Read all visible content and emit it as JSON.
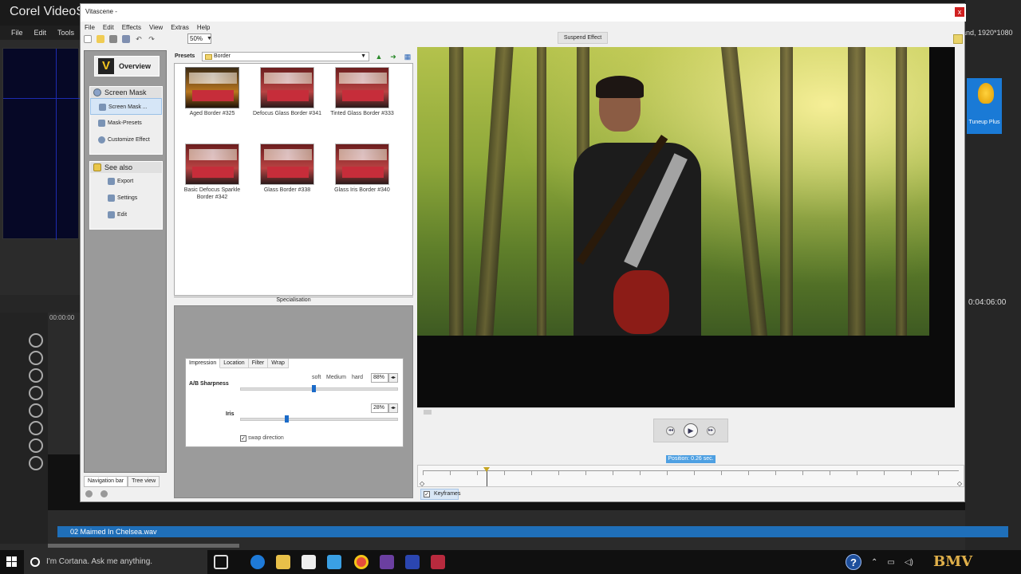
{
  "corel": {
    "app_title": "Corel VideoS",
    "menu": [
      "File",
      "Edit",
      "Tools"
    ],
    "resolution": "and, 1920*1080",
    "timecode": "0:04:06:00",
    "track_timecode": "00:00:00",
    "library_item": "Tuneup Plus",
    "audio_clip": "02 Maimed In Chelsea.wav"
  },
  "vitascene": {
    "title": "Vitascene -",
    "close": "x",
    "menu": [
      "File",
      "Edit",
      "Effects",
      "View",
      "Extras",
      "Help"
    ],
    "zoom": "50%",
    "suspend_label": "Suspend Effect"
  },
  "nav": {
    "overview": "Overview",
    "screen_mask": {
      "title": "Screen Mask",
      "items": [
        "Screen Mask ...",
        "Mask-Presets",
        "Customize Effect"
      ]
    },
    "see_also": {
      "title": "See also",
      "items": [
        "Export",
        "Settings",
        "Edit"
      ]
    },
    "tabs": [
      "Navigation bar",
      "Tree view"
    ]
  },
  "presets": {
    "label": "Presets",
    "folder": "Border",
    "items": [
      {
        "name": "Aged Border #325"
      },
      {
        "name": "Defocus Glass Border #341"
      },
      {
        "name": "Tinted Glass Border #333"
      },
      {
        "name": "Basic Defocus Sparkle Border #342"
      },
      {
        "name": "Glass Border #338"
      },
      {
        "name": "Glass Iris Border #340"
      }
    ]
  },
  "specialisation": {
    "label": "Specialisation",
    "tabs": [
      "Impression",
      "Location",
      "Filter",
      "Wrap"
    ],
    "ab_sharpness": {
      "label": "A/B Sharpness",
      "value": "88%",
      "level": 0.45,
      "scale": [
        "soft",
        "Medium",
        "hard"
      ]
    },
    "iris": {
      "label": "Iris",
      "value": "28%",
      "level": 0.28
    },
    "swap_direction": "swap direction"
  },
  "timeline": {
    "position": "Position: 0.26 sec.",
    "keyframes": "Keyframes"
  },
  "taskbar": {
    "cortana": "I'm Cortana. Ask me anything."
  },
  "watermark": "BMV"
}
